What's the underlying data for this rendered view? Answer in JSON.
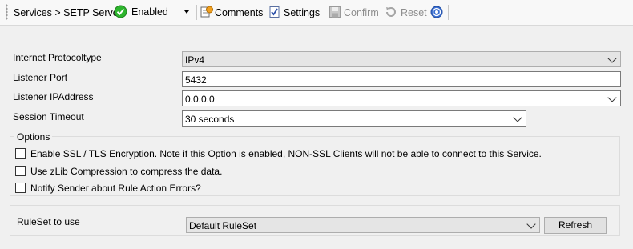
{
  "toolbar": {
    "breadcrumb": "Services > SETP Server",
    "status_value": "Enabled",
    "comments_label": "Comments",
    "settings_label": "Settings",
    "confirm_label": "Confirm",
    "reset_label": "Reset"
  },
  "form": {
    "protocol": {
      "label": "Internet Protocoltype",
      "value": "IPv4"
    },
    "port": {
      "label": "Listener Port",
      "value": "5432"
    },
    "ip": {
      "label": "Listener IPAddress",
      "value": "0.0.0.0"
    },
    "timeout": {
      "label": "Session Timeout",
      "value": "30 seconds"
    }
  },
  "options": {
    "title": "Options",
    "items": [
      {
        "label": "Enable SSL / TLS Encryption. Note if this Option is enabled, NON-SSL Clients will not be able to connect to this Service.",
        "checked": false
      },
      {
        "label": "Use zLib Compression to compress the data.",
        "checked": false
      },
      {
        "label": "Notify Sender about Rule Action Errors?",
        "checked": false
      }
    ]
  },
  "ruleset": {
    "label": "RuleSet to use",
    "value": "Default RuleSet",
    "refresh_label": "Refresh"
  },
  "colors": {
    "status_green": "#2db52d",
    "help_blue": "#3b6fd1"
  }
}
